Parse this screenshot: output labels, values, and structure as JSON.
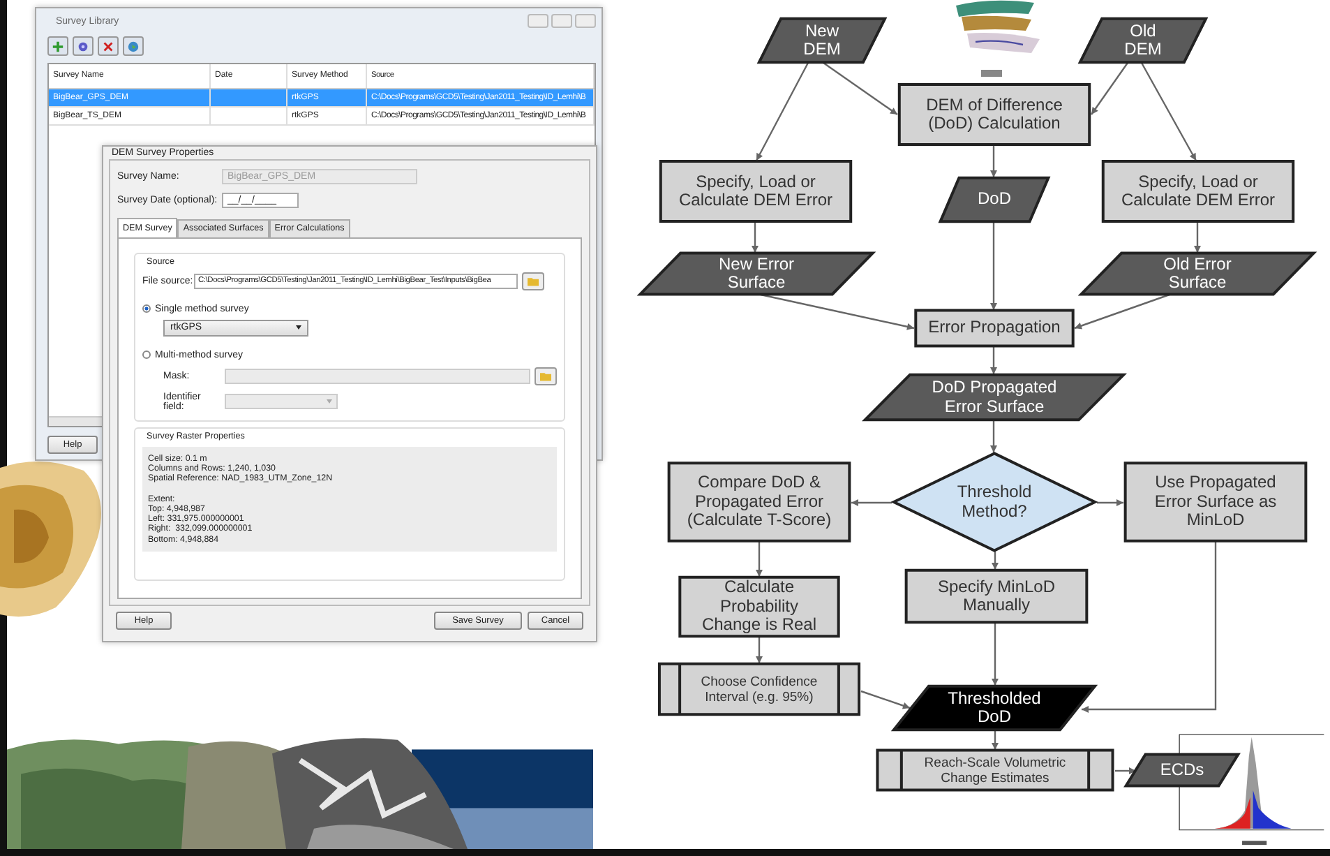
{
  "survey_library": {
    "title": "Survey Library",
    "columns": [
      "Survey Name",
      "Date",
      "Survey Method",
      "Source"
    ],
    "rows": [
      {
        "cells": [
          "BigBear_GPS_DEM",
          "",
          "rtkGPS",
          "C:\\Docs\\Programs\\GCD5\\Testing\\Jan2011_Testing\\ID_Lemhi\\B"
        ],
        "selected": true
      },
      {
        "cells": [
          "BigBear_TS_DEM",
          "",
          "rtkGPS",
          "C:\\Docs\\Programs\\GCD5\\Testing\\Jan2011_Testing\\ID_Lemhi\\B"
        ],
        "selected": false
      }
    ],
    "buttons": [
      "Help"
    ]
  },
  "dem_survey_properties": {
    "title": "DEM Survey Properties",
    "fields": [
      {
        "label": "Survey Name:",
        "value": "BigBear_GPS_DEM",
        "disabled": true
      },
      {
        "label": "Survey Date (optional):",
        "value": "__/__/____",
        "disabled": false
      }
    ],
    "tabs": [
      {
        "label": "DEM Survey",
        "selected": true
      },
      {
        "label": "Associated Surfaces",
        "selected": false
      },
      {
        "label": "Error Calculations",
        "selected": false
      }
    ],
    "source": {
      "title": "Source",
      "file_source_label": "File source:",
      "file_source": "C:\\Docs\\Programs\\GCD5\\Testing\\Jan2011_Testing\\ID_Lemhi\\BigBear_Test\\Inputs\\BigBea",
      "options": [
        {
          "label": "Single method survey",
          "selected": true
        },
        {
          "label": "Multi-method survey",
          "selected": false
        }
      ],
      "method": "rtkGPS",
      "mask_label": "Mask:",
      "identifier_label": "Identifier field:"
    },
    "raster": {
      "title": "Survey Raster Properties",
      "blocks": [
        [
          "Cell size: 0.1 m",
          "Columns and Rows: 1,240, 1,030",
          "Spatial Reference: NAD_1983_UTM_Zone_12N"
        ],
        [
          "Extent:",
          "Top: 4,948,987",
          "Left: 331,975.000000001",
          "Right:  332,099.000000001",
          "Bottom: 4,948,884"
        ]
      ]
    },
    "buttons": [
      "Help",
      "Save Survey",
      "Cancel"
    ]
  },
  "flowchart": {
    "nodes": [
      {
        "kind": "data",
        "lines": [
          "New",
          "DEM"
        ]
      },
      {
        "kind": "data",
        "lines": [
          "Old",
          "DEM"
        ]
      },
      {
        "kind": "process",
        "lines": [
          "DEM of Difference",
          "(DoD) Calculation"
        ]
      },
      {
        "kind": "process",
        "lines": [
          "Specify, Load or",
          "Calculate DEM Error"
        ]
      },
      {
        "kind": "data",
        "lines": [
          "DoD"
        ]
      },
      {
        "kind": "process",
        "lines": [
          "Specify, Load or",
          "Calculate DEM Error"
        ]
      },
      {
        "kind": "data",
        "lines": [
          "New Error",
          "Surface"
        ]
      },
      {
        "kind": "data",
        "lines": [
          "Old Error",
          "Surface"
        ]
      },
      {
        "kind": "process",
        "lines": [
          "Error Propagation"
        ]
      },
      {
        "kind": "data",
        "lines": [
          "DoD Propagated",
          "Error Surface"
        ]
      },
      {
        "kind": "process",
        "lines": [
          "Compare DoD &",
          "Propagated Error",
          "(Calculate T-Score)"
        ]
      },
      {
        "kind": "decision",
        "lines": [
          "Threshold",
          "Method?"
        ]
      },
      {
        "kind": "process",
        "lines": [
          "Use Propagated",
          "Error Surface as",
          "MinLoD"
        ]
      },
      {
        "kind": "process",
        "lines": [
          "Calculate",
          "Probability",
          "Change is Real"
        ]
      },
      {
        "kind": "process",
        "lines": [
          "Specify MinLoD",
          "Manually"
        ]
      },
      {
        "kind": "subprocess",
        "lines": [
          "Choose Confidence",
          "Interval (e.g. 95%)"
        ]
      },
      {
        "kind": "output",
        "lines": [
          "Thresholded",
          "DoD"
        ]
      },
      {
        "kind": "subprocess",
        "lines": [
          "Reach-Scale Volumetric",
          "Change Estimates"
        ]
      },
      {
        "kind": "data",
        "lines": [
          "ECDs"
        ]
      }
    ]
  }
}
